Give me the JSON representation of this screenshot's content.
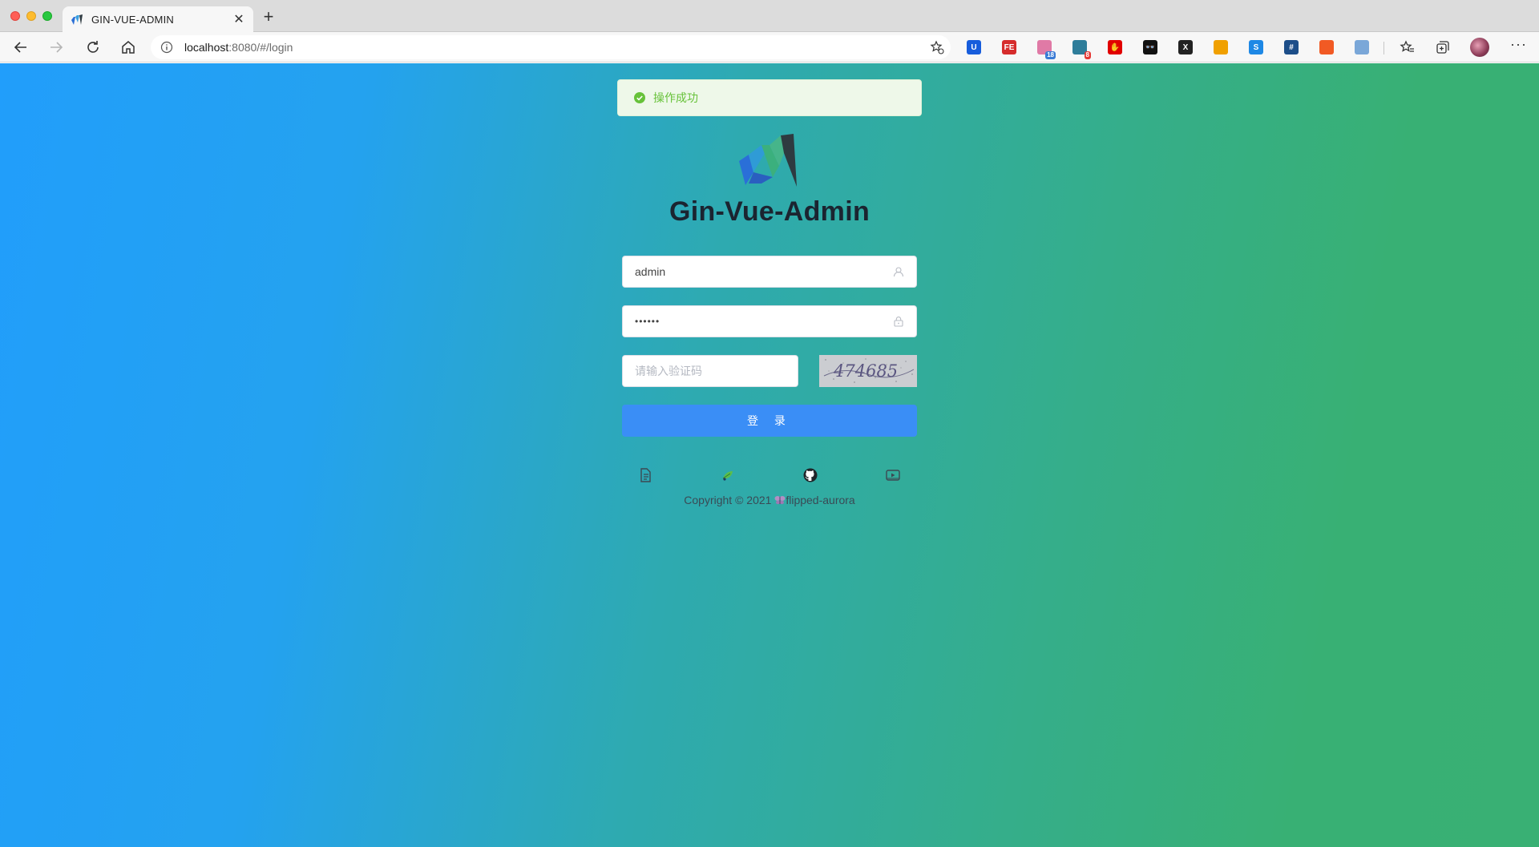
{
  "browser": {
    "tab_title": "GIN-VUE-ADMIN",
    "tab_close": "✕",
    "new_tab": "+",
    "url_host": "localhost",
    "url_rest": ":8080/#/login",
    "more": "···",
    "extensions": [
      {
        "name": "bitwarden-icon",
        "color": "#175ddc",
        "glyph": "U"
      },
      {
        "name": "fe-helper-icon",
        "color": "#d62c2c",
        "glyph": "FE"
      },
      {
        "name": "cat-icon",
        "color": "#e07aa6",
        "glyph": "",
        "badge": "18",
        "badge_color": "#3a7bd5"
      },
      {
        "name": "grid-extension-icon",
        "color": "#2e7d9a",
        "glyph": "",
        "badge": "8",
        "badge_color": "#e53935"
      },
      {
        "name": "adblock-icon",
        "color": "#e10000",
        "glyph": "✋"
      },
      {
        "name": "glasses-icon",
        "color": "#111111",
        "glyph": "👓"
      },
      {
        "name": "x-extension-icon",
        "color": "#222222",
        "glyph": "X"
      },
      {
        "name": "colorful-grid-icon",
        "color": "#f0a000",
        "glyph": ""
      },
      {
        "name": "s-extension-icon",
        "color": "#1e88e5",
        "glyph": "S"
      },
      {
        "name": "hash-extension-icon",
        "color": "#1d4e89",
        "glyph": "#"
      },
      {
        "name": "tree-extension-icon",
        "color": "#f15a24",
        "glyph": ""
      },
      {
        "name": "pin-extension-icon",
        "color": "#7aa7d8",
        "glyph": ""
      }
    ]
  },
  "toast": {
    "message": "操作成功",
    "status_color": "#67c23a"
  },
  "brand": {
    "title": "Gin-Vue-Admin"
  },
  "form": {
    "username_value": "admin",
    "password_value": "••••••",
    "captcha_placeholder": "请输入验证码",
    "captcha_code": "474685",
    "login_label": "登 录"
  },
  "footer": {
    "links": [
      "docs-icon",
      "plugin-leaf-icon",
      "github-icon",
      "video-icon"
    ],
    "copyright": "Copyright © 2021",
    "org": "flipped-aurora"
  },
  "colors": {
    "page_gradient_start": "#219efb",
    "page_gradient_end": "#39b074",
    "primary_button": "#3a8ef6"
  }
}
